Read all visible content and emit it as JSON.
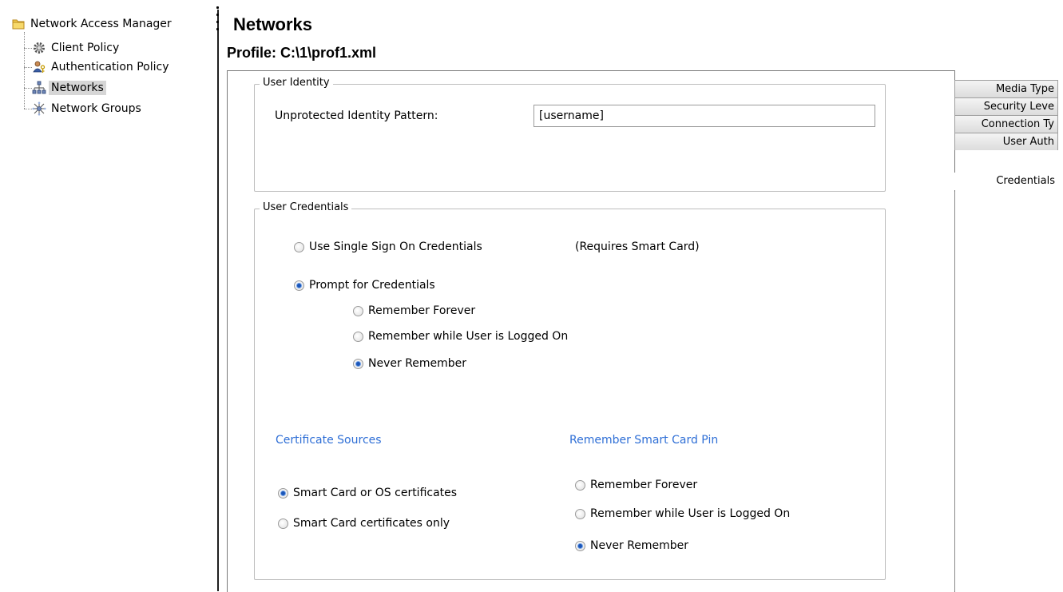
{
  "tree": {
    "root_label": "Network Access Manager",
    "items": [
      {
        "label": "Client Policy",
        "icon": "gear-icon"
      },
      {
        "label": "Authentication Policy",
        "icon": "user-key-icon"
      },
      {
        "label": "Networks",
        "icon": "network-icon",
        "selected": true
      },
      {
        "label": "Network Groups",
        "icon": "network-groups-icon"
      }
    ]
  },
  "header": {
    "title": "Networks",
    "profile": "Profile:  C:\\1\\prof1.xml"
  },
  "user_identity": {
    "group_title": "User Identity",
    "pattern_label": "Unprotected Identity Pattern:",
    "pattern_value": "[username]"
  },
  "user_credentials": {
    "group_title": "User Credentials",
    "sso_label": "Use Single Sign On Credentials",
    "sso_note": "(Requires Smart Card)",
    "sso_checked": false,
    "prompt_label": "Prompt for Credentials",
    "prompt_checked": true,
    "remember_options": [
      {
        "label": "Remember Forever",
        "checked": false
      },
      {
        "label": "Remember while User is Logged On",
        "checked": false
      },
      {
        "label": "Never Remember",
        "checked": true
      }
    ],
    "certificate_sources": {
      "heading": "Certificate Sources",
      "options": [
        {
          "label": "Smart Card or OS certificates",
          "checked": true
        },
        {
          "label": "Smart Card certificates only",
          "checked": false
        }
      ]
    },
    "smart_card_pin": {
      "heading": "Remember Smart Card Pin",
      "options": [
        {
          "label": "Remember Forever",
          "checked": false
        },
        {
          "label": "Remember while User is Logged On",
          "checked": false
        },
        {
          "label": "Never Remember",
          "checked": true
        }
      ]
    }
  },
  "tabs": [
    {
      "label": "Media Type",
      "active": false
    },
    {
      "label": "Security Leve",
      "active": false
    },
    {
      "label": "Connection Ty",
      "active": false
    },
    {
      "label": "User Auth",
      "active": false
    },
    {
      "label": "Credentials",
      "active": true
    }
  ],
  "colors": {
    "accent_blue": "#2f6fd6",
    "selection_gray": "#d6d6d6",
    "radio_dot": "#1c56b8"
  }
}
